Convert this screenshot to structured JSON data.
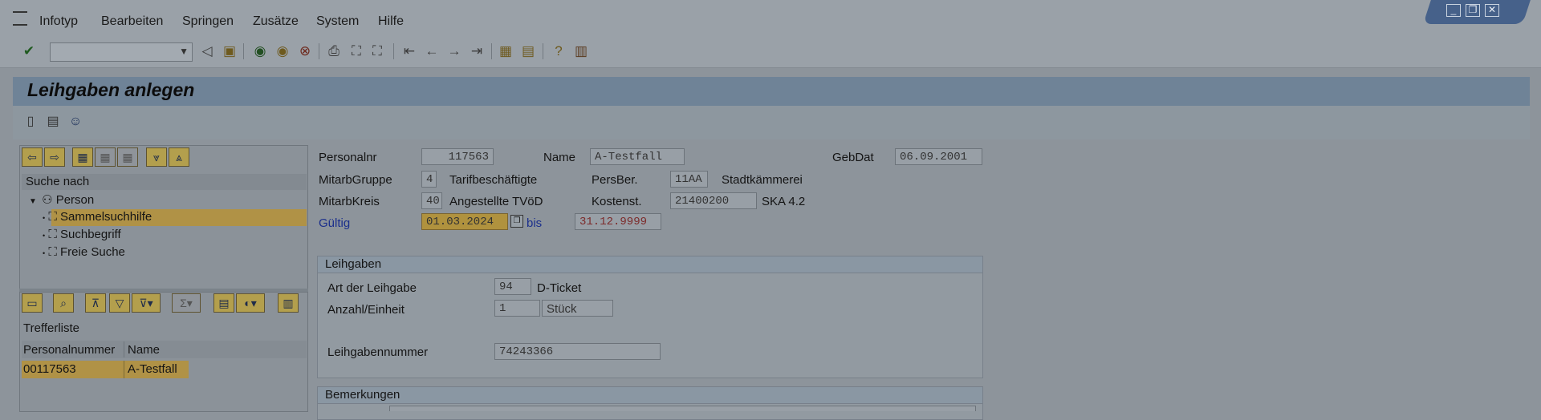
{
  "menu": {
    "items": [
      "Infotyp",
      "Bearbeiten",
      "Springen",
      "Zusätze",
      "System",
      "Hilfe"
    ]
  },
  "toolbar": {
    "command_field_value": "",
    "icons": [
      "check-icon",
      "back-icon",
      "save-icon",
      "green-arrow-icon",
      "exit-icon",
      "cancel-icon",
      "print-icon",
      "find-icon",
      "find-next-icon",
      "first-page-icon",
      "prev-page-icon",
      "next-page-icon",
      "last-page-icon",
      "new-session-icon",
      "shortcut-icon",
      "help-icon",
      "layout-icon"
    ]
  },
  "page": {
    "title": "Leihgaben anlegen"
  },
  "search": {
    "header": "Suche nach",
    "root": "Person",
    "items": [
      "Sammelsuchhilfe",
      "Suchbegriff",
      "Freie Suche"
    ],
    "selected_index": 0
  },
  "hitlist": {
    "title": "Trefferliste",
    "columns": [
      "Personalnummer",
      "Name"
    ],
    "rows": [
      {
        "personalnummer": "00117563",
        "name": "A-Testfall"
      }
    ]
  },
  "header": {
    "personalnr_label": "Personalnr",
    "personalnr_value": "117563",
    "name_label": "Name",
    "name_value": "A-Testfall",
    "gebdat_label": "GebDat",
    "gebdat_value": "06.09.2001",
    "mitarbgruppe_label": "MitarbGruppe",
    "mitarbgruppe_value": "4",
    "mitarbgruppe_text": "Tarifbeschäftigte",
    "persber_label": "PersBer.",
    "persber_value": "11AA",
    "persber_text": "Stadtkämmerei",
    "mitarbkreis_label": "MitarbKreis",
    "mitarbkreis_value": "40",
    "mitarbkreis_text": "Angestellte TVöD",
    "kostenst_label": "Kostenst.",
    "kostenst_value": "21400200",
    "kostenst_text": "SKA 4.2",
    "gueltig_label": "Gültig",
    "gueltig_from": "01.03.2024",
    "bis_label": "bis",
    "gueltig_to": "31.12.9999"
  },
  "leihgaben": {
    "title": "Leihgaben",
    "art_label": "Art der Leihgabe",
    "art_value": "94",
    "art_text": "D-Ticket",
    "anzahl_label": "Anzahl/Einheit",
    "anzahl_value": "1",
    "einheit_value": "Stück",
    "nummer_label": "Leihgabennummer",
    "nummer_value": "74243366"
  },
  "bemerkungen": {
    "title": "Bemerkungen"
  },
  "colors": {
    "selection": "#b09246",
    "label_blue": "#1b2f8c",
    "title_bar": "#6f8397"
  }
}
